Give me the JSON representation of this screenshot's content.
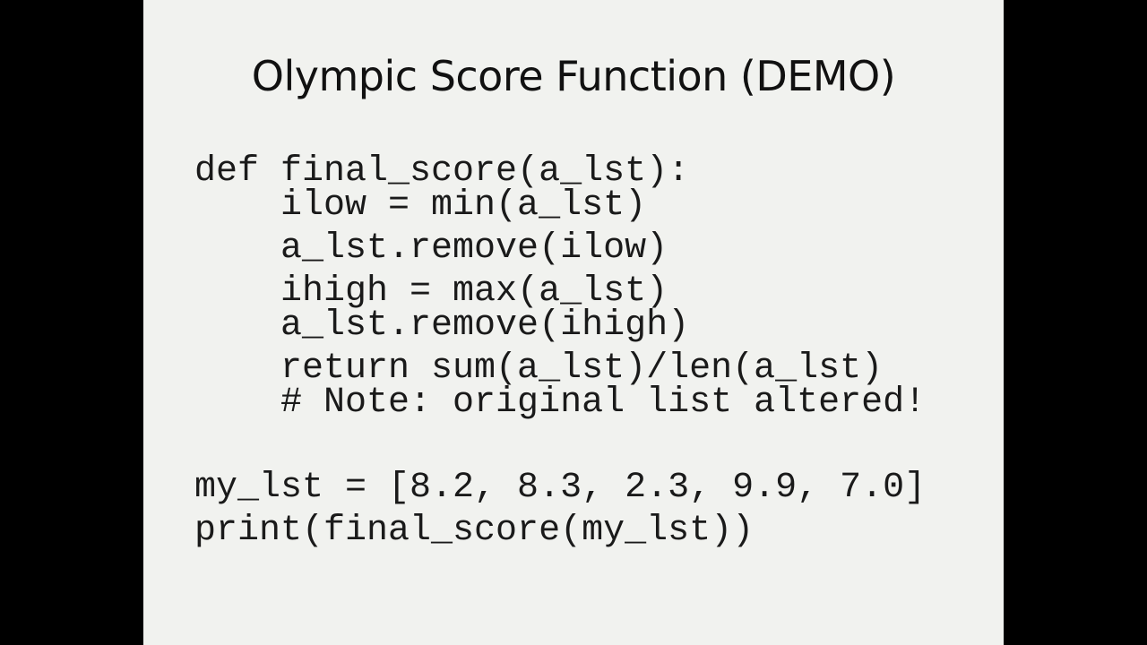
{
  "slide": {
    "title": "Olympic Score Function (DEMO)",
    "code_lines": [
      "def final_score(a_lst):",
      "    ilow = min(a_lst)",
      "    a_lst.remove(ilow)",
      "    ihigh = max(a_lst)",
      "    a_lst.remove(ihigh)",
      "    return sum(a_lst)/len(a_lst)",
      "    # Note: original list altered!",
      "my_lst = [8.2, 8.3, 2.3, 9.9, 7.0]",
      "print(final_score(my_lst))"
    ]
  },
  "colors": {
    "background": "#000000",
    "slide_background": "#f1f2ef",
    "text": "#111111"
  }
}
